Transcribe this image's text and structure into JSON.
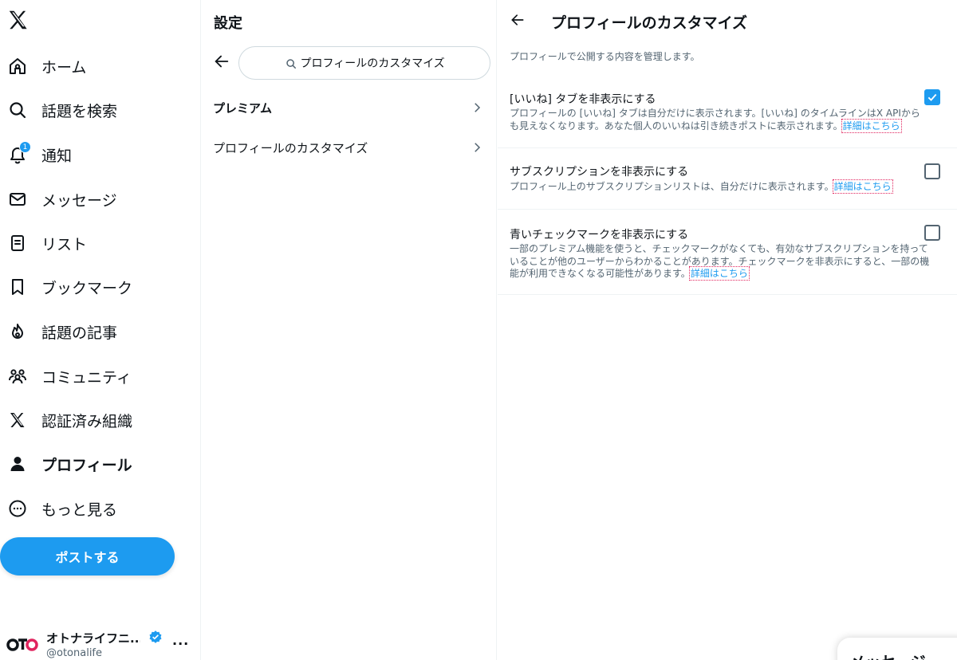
{
  "nav": {
    "items": [
      {
        "label": "ホーム",
        "icon": "home-icon"
      },
      {
        "label": "話題を検索",
        "icon": "search-icon"
      },
      {
        "label": "通知",
        "icon": "bell-icon",
        "badge": "1"
      },
      {
        "label": "メッセージ",
        "icon": "mail-icon"
      },
      {
        "label": "リスト",
        "icon": "list-icon"
      },
      {
        "label": "ブックマーク",
        "icon": "bookmark-icon"
      },
      {
        "label": "話題の記事",
        "icon": "flame-icon"
      },
      {
        "label": "コミュニティ",
        "icon": "people-icon"
      },
      {
        "label": "認証済み組織",
        "icon": "x-logo-icon"
      },
      {
        "label": "プロフィール",
        "icon": "person-icon"
      },
      {
        "label": "もっと見る",
        "icon": "more-circle-icon"
      }
    ],
    "post_button": "ポストする",
    "account": {
      "name": "オトナライフニ...",
      "handle": "@otonalife",
      "more": "..."
    }
  },
  "settings": {
    "title": "設定",
    "search_value": "プロフィールのカスタマイズ",
    "rows": [
      {
        "label": "プレミアム"
      },
      {
        "label": "プロフィールのカスタマイズ"
      }
    ]
  },
  "detail": {
    "title": "プロフィールのカスタマイズ",
    "subtitle": "プロフィールで公開する内容を管理します。",
    "options": [
      {
        "title": "[いいね] タブを非表示にする",
        "description": "プロフィールの [いいね] タブは自分だけに表示されます。[いいね] のタイムラインはX APIからも見えなくなります。あなた個人のいいねは引き続きポストに表示されます。",
        "link": "詳細はこちら",
        "checked": true
      },
      {
        "title": "サブスクリプションを非表示にする",
        "description": "プロフィール上のサブスクリプションリストは、自分だけに表示されます。",
        "link": "詳細はこちら",
        "checked": false
      },
      {
        "title": "青いチェックマークを非表示にする",
        "description": "一部のプレミアム機能を使うと、チェックマークがなくても、有効なサブスクリプションを持っていることが他のユーザーからわかることがあります。チェックマークを非表示にすると、一部の機能が利用できなくなる可能性があります。",
        "link": "詳細はこちら",
        "checked": false
      }
    ]
  },
  "messages_drawer": {
    "label": "メッセージ"
  },
  "colors": {
    "accent": "#1d9bf0",
    "text": "#0f1419",
    "muted": "#536471"
  }
}
